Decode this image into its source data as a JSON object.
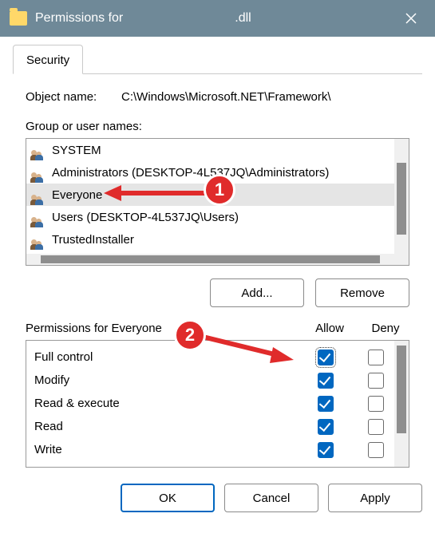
{
  "titlebar": {
    "prefix": "Permissions for",
    "middle_gap": "                          ",
    "suffix": ".dll"
  },
  "tab": {
    "security": "Security"
  },
  "object": {
    "label": "Object name:",
    "value": "C:\\Windows\\Microsoft.NET\\Framework\\"
  },
  "groups": {
    "label": "Group or user names:",
    "items": [
      {
        "name": "SYSTEM",
        "selected": false
      },
      {
        "name": "Administrators (DESKTOP-4L537JQ\\Administrators)",
        "selected": false
      },
      {
        "name": "Everyone",
        "selected": true
      },
      {
        "name": "Users (DESKTOP-4L537JQ\\Users)",
        "selected": false
      },
      {
        "name": "TrustedInstaller",
        "selected": false
      }
    ]
  },
  "buttons": {
    "add": "Add...",
    "remove": "Remove",
    "ok": "OK",
    "cancel": "Cancel",
    "apply": "Apply"
  },
  "perm": {
    "label": "Permissions for Everyone",
    "allow": "Allow",
    "deny": "Deny",
    "rows": [
      {
        "name": "Full control",
        "allow": true,
        "deny": false,
        "focus": true
      },
      {
        "name": "Modify",
        "allow": true,
        "deny": false
      },
      {
        "name": "Read & execute",
        "allow": true,
        "deny": false
      },
      {
        "name": "Read",
        "allow": true,
        "deny": false
      },
      {
        "name": "Write",
        "allow": true,
        "deny": false
      }
    ]
  },
  "annotations": {
    "badge1": "1",
    "badge2": "2",
    "color": "#e02b2b"
  }
}
